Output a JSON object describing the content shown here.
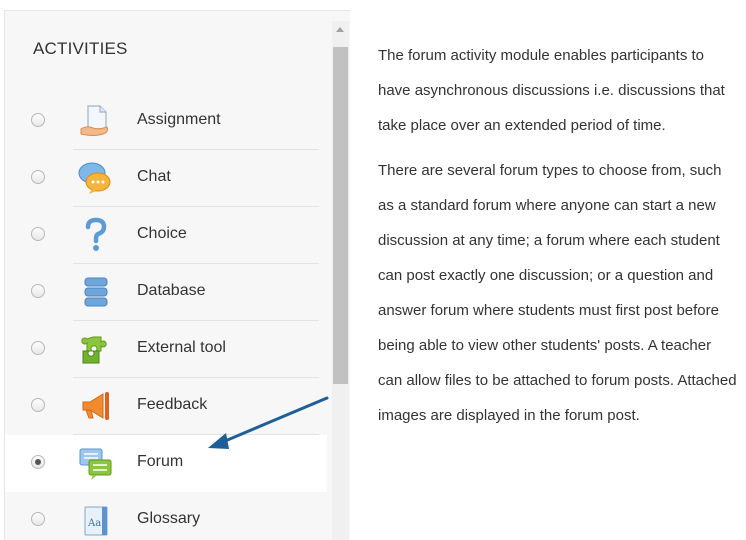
{
  "activities": {
    "title": "ACTIVITIES",
    "items": [
      {
        "label": "Assignment",
        "icon": "assignment-icon",
        "selected": false
      },
      {
        "label": "Chat",
        "icon": "chat-icon",
        "selected": false
      },
      {
        "label": "Choice",
        "icon": "choice-icon",
        "selected": false
      },
      {
        "label": "Database",
        "icon": "database-icon",
        "selected": false
      },
      {
        "label": "External tool",
        "icon": "external-tool-icon",
        "selected": false
      },
      {
        "label": "Feedback",
        "icon": "feedback-icon",
        "selected": false
      },
      {
        "label": "Forum",
        "icon": "forum-icon",
        "selected": true
      },
      {
        "label": "Glossary",
        "icon": "glossary-icon",
        "selected": false
      }
    ]
  },
  "description": {
    "paragraphs": [
      "The forum activity module enables participants to have asynchronous discussions i.e. discussions that take place over an extended period of time.",
      "There are several forum types to choose from, such as a standard forum where anyone can start a new discussion at any time; a forum where each student can post exactly one discussion; or a question and answer forum where students must first post before being able to view other students' posts. A teacher can allow files to be attached to forum posts. Attached images are displayed in the forum post."
    ]
  },
  "colors": {
    "panel_bg": "#f7f7f7",
    "selected_bg": "#ffffff",
    "arrow": "#1f5f99"
  }
}
